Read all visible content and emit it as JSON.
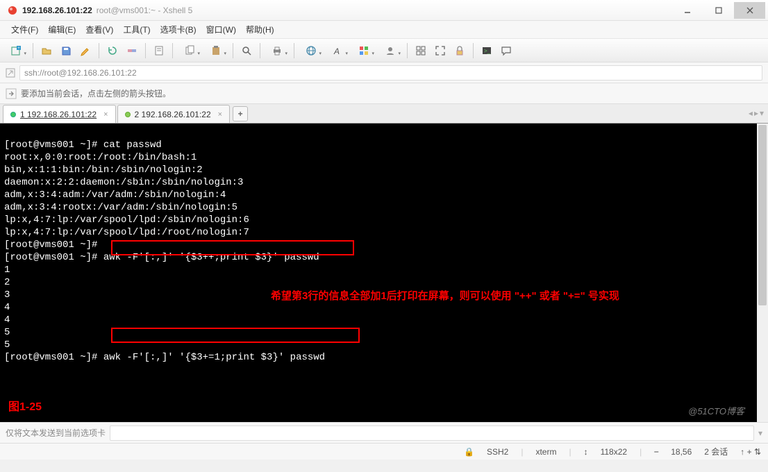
{
  "window": {
    "ip_title": "192.168.26.101:22",
    "subtitle": "root@vms001:~ - Xshell 5"
  },
  "menu": {
    "file": "文件(F)",
    "edit": "编辑(E)",
    "view": "查看(V)",
    "tools": "工具(T)",
    "tabs": "选项卡(B)",
    "window": "窗口(W)",
    "help": "帮助(H)"
  },
  "addressbar": {
    "url": "ssh://root@192.168.26.101:22"
  },
  "hintbar": {
    "text": "要添加当前会话，点击左侧的箭头按钮。"
  },
  "tabs": {
    "tab1": "1 192.168.26.101:22",
    "tab2": "2 192.168.26.101:22",
    "add": "+"
  },
  "terminal": {
    "lines": "[root@vms001 ~]# cat passwd\nroot:x,0:0:root:/root:/bin/bash:1\nbin,x:1:1:bin:/bin:/sbin/nologin:2\ndaemon:x:2:2:daemon:/sbin:/sbin/nologin:3\nadm,x:3:4:adm:/var/adm:/sbin/nologin:4\nadm,x:3:4:rootx:/var/adm:/sbin/nologin:5\nlp:x,4:7:lp:/var/spool/lpd:/sbin/nologin:6\nlp:x,4:7:lp:/var/spool/lpd:/root/nologin:7\n[root@vms001 ~]#\n[root@vms001 ~]# awk -F'[:,]' '{$3++;print $3}' passwd\n1\n2\n3\n4\n4\n5\n5\n[root@vms001 ~]# awk -F'[:,]' '{$3+=1;print $3}' passwd",
    "annotation": "希望第3行的信息全部加1后打印在屏幕，则可以使用 \"++\" 或者 \"+=\" 号实现",
    "figure_label": "图1-25",
    "watermark": "@51CTO博客"
  },
  "sendbar": {
    "placeholder": "仅将文本发送到当前选项卡"
  },
  "status": {
    "proto": "SSH2",
    "term": "xterm",
    "size": "118x22",
    "pos": "18,56",
    "sessions": "2 会话",
    "extra": "↑  +  ⇅"
  }
}
